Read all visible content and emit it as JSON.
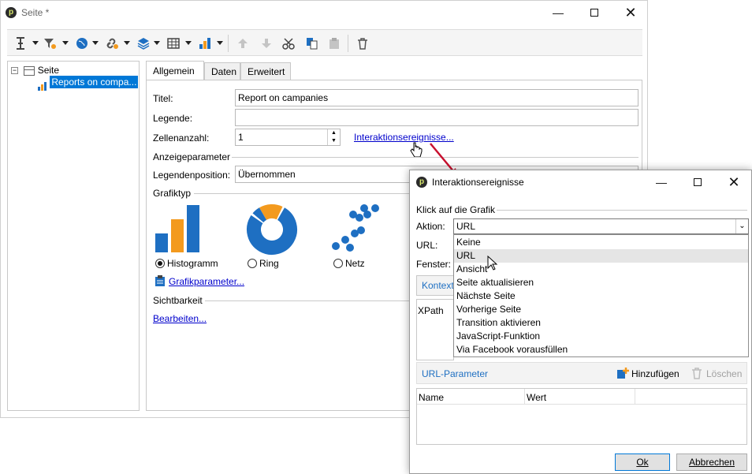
{
  "main_window": {
    "title": "Seite *",
    "tree": {
      "root_label": "Seite",
      "child_label": "Reports on compa..."
    },
    "tabs": [
      "Allgemein",
      "Daten",
      "Erweitert"
    ],
    "form": {
      "titel_label": "Titel:",
      "titel_value": "Report on campanies",
      "legende_label": "Legende:",
      "legende_value": "",
      "zellen_label": "Zellenanzahl:",
      "zellen_value": "1",
      "interaktion_link": "Interaktionsereignisse...",
      "anzeige_section": "Anzeigeparameter",
      "legendenpos_label": "Legendenposition:",
      "legendenpos_value": "Übernommen",
      "grafiktyp_section": "Grafiktyp",
      "chart_types": [
        {
          "label": "Histogramm",
          "selected": true
        },
        {
          "label": "Ring",
          "selected": false
        },
        {
          "label": "Netz",
          "selected": false
        }
      ],
      "grafikparameter_link": "Grafikparameter...",
      "sichtbarkeit_section": "Sichtbarkeit",
      "bearbeiten_link": "Bearbeiten..."
    }
  },
  "dialog": {
    "title": "Interaktionsereignisse",
    "section": "Klick auf die Grafik",
    "aktion_label": "Aktion:",
    "aktion_value": "URL",
    "url_label": "URL:",
    "fenster_label": "Fenster:",
    "kontext_tab": "Kontext",
    "xpath_header": "XPath",
    "dropdown_options": [
      "Keine",
      "URL",
      "Ansicht",
      "Seite aktualisieren",
      "Nächste Seite",
      "Vorherige Seite",
      "Transition aktivieren",
      "JavaScript-Funktion",
      "Via Facebook vorausfüllen"
    ],
    "dropdown_hover_index": 1,
    "url_params_label": "URL-Parameter",
    "add_label": "Hinzufügen",
    "delete_label": "Löschen",
    "col_name": "Name",
    "col_wert": "Wert",
    "ok_label": "Ok",
    "cancel_label": "Abbrechen"
  },
  "colors": {
    "accent_blue": "#1e6fc2",
    "orange": "#f39a1e",
    "selection": "#0078d7",
    "link": "#0000cc"
  }
}
